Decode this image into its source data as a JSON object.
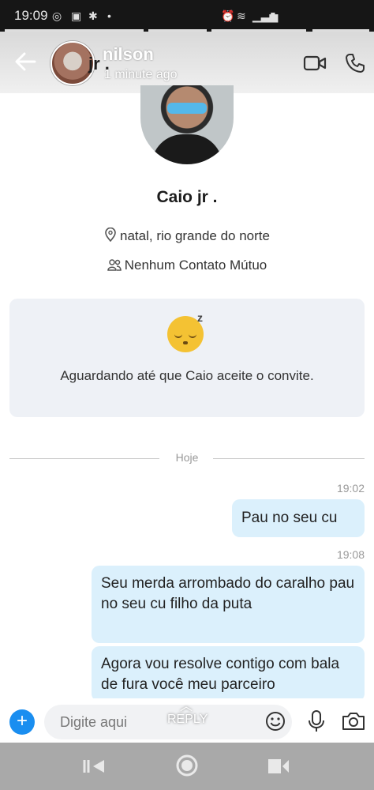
{
  "status_bar": {
    "time": "19:09"
  },
  "header": {
    "title": "nilson",
    "title_overlap": "jr .",
    "subtitle": "1 minute ago"
  },
  "profile": {
    "name": "Caio jr .",
    "location": "natal, rio grande do norte",
    "mutual": "Nenhum Contato Mútuo"
  },
  "waiting_card": {
    "message": "Aguardando até que Caio aceite o convite."
  },
  "divider": {
    "label": "Hoje"
  },
  "messages": [
    {
      "time": "19:02",
      "text": "Pau no seu cu"
    },
    {
      "time": "19:08",
      "text": "Seu merda arrombado  do caralho pau no seu     cu filho da puta"
    },
    {
      "text": "Agora vou resolve contigo com bala   de fura você meu parceiro"
    }
  ],
  "composer": {
    "placeholder": "Digite aqui",
    "reply_label": "REPLY"
  },
  "colors": {
    "accent": "#1a8ef0",
    "bubble": "#dbf0fc",
    "card": "#eef1f6"
  }
}
